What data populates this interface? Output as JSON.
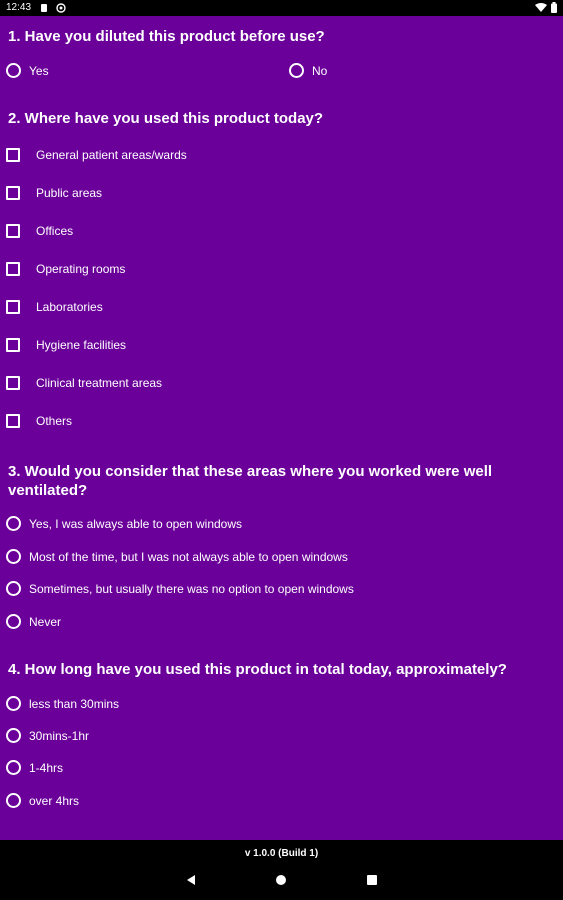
{
  "status_bar": {
    "time": "12:43"
  },
  "questions": {
    "q1": {
      "text": "1. Have you diluted this product before use?",
      "options": [
        "Yes",
        "No"
      ]
    },
    "q2": {
      "text": "2. Where have you used this product today?",
      "options": [
        "General patient areas/wards",
        "Public areas",
        "Offices",
        "Operating rooms",
        "Laboratories",
        "Hygiene facilities",
        "Clinical treatment areas",
        "Others"
      ]
    },
    "q3": {
      "text": "3. Would you consider that these areas where you worked were well ventilated?",
      "options": [
        "Yes, I was always able to open windows",
        "Most of the time, but I was not always able to open windows",
        "Sometimes, but usually there was no option to open windows",
        "Never"
      ]
    },
    "q4": {
      "text": "4. How long have you used this product in total today, approximately?",
      "options": [
        "less than 30mins",
        "30mins-1hr",
        "1-4hrs",
        "over 4hrs"
      ]
    }
  },
  "footer": {
    "version": "v 1.0.0 (Build 1)"
  },
  "colors": {
    "background": "#6a0099",
    "bars": "#000000",
    "text": "#ffffff"
  },
  "icons": {
    "status": [
      "notification-icon",
      "at-icon",
      "wifi-icon",
      "battery-icon"
    ],
    "nav": [
      "back-icon",
      "home-icon",
      "recent-apps-icon"
    ]
  }
}
